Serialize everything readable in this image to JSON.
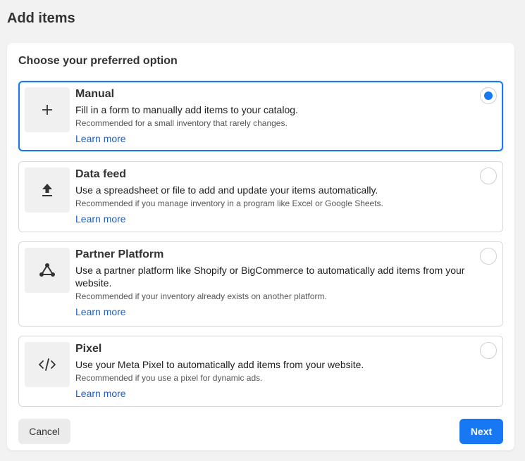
{
  "page": {
    "title": "Add items"
  },
  "card": {
    "heading": "Choose your preferred option"
  },
  "options": [
    {
      "icon": "plus-icon",
      "title": "Manual",
      "description": "Fill in a form to manually add items to your catalog.",
      "recommendation": "Recommended for a small inventory that rarely changes.",
      "link": "Learn more",
      "selected": true
    },
    {
      "icon": "upload-icon",
      "title": "Data feed",
      "description": "Use a spreadsheet or file to add and update your items automatically.",
      "recommendation": "Recommended if you manage inventory in a program like Excel or Google Sheets.",
      "link": "Learn more",
      "selected": false
    },
    {
      "icon": "partner-network-icon",
      "title": "Partner Platform",
      "description": "Use a partner platform like Shopify or BigCommerce to automatically add items from your website.",
      "recommendation": "Recommended if your inventory already exists on another platform.",
      "link": "Learn more",
      "selected": false
    },
    {
      "icon": "code-icon",
      "title": "Pixel",
      "description": "Use your Meta Pixel to automatically add items from your website.",
      "recommendation": "Recommended if you use a pixel for dynamic ads.",
      "link": "Learn more",
      "selected": false
    }
  ],
  "footer": {
    "cancel_label": "Cancel",
    "next_label": "Next"
  },
  "colors": {
    "accent": "#1877f2",
    "link": "#1d5fbf",
    "background": "#f2f2f2"
  }
}
